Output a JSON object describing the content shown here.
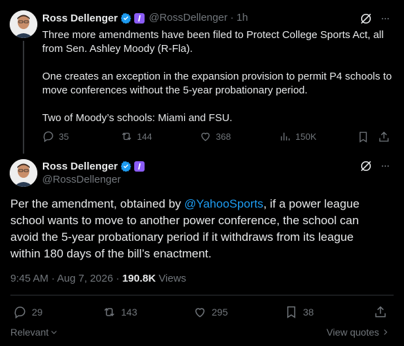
{
  "tweet1": {
    "name": "Ross Dellenger",
    "handle": "@RossDellenger",
    "time": "1h",
    "paragraphs": [
      "Three more amendments have been filed to Protect College Sports Act, all from Sen. Ashley Moody (R-Fla).",
      "One creates an exception in the expansion provision to permit P4 schools to move conferences without the 5-year probationary period.",
      "Two of Moody’s schools: Miami and FSU."
    ],
    "replies": "35",
    "reposts": "144",
    "likes": "368",
    "views": "150K"
  },
  "tweet2": {
    "name": "Ross Dellenger",
    "handle": "@RossDellenger",
    "text_before": "Per the amendment, obtained by ",
    "mention": "@YahooSports",
    "text_after": ", if a power league school wants to move to another power conference, the school can avoid the 5-year probationary period if it withdraws from its league within 180 days of the bill’s enactment.",
    "timestamp": "9:45 AM · Aug 7, 2026 · ",
    "views_count": "190.8K",
    "views_label": " Views",
    "replies": "29",
    "reposts": "143",
    "likes": "295",
    "bookmarks": "38"
  },
  "footer": {
    "sort_label": "Relevant",
    "view_quotes": "View quotes"
  },
  "colors": {
    "background": "#000000",
    "text": "#e7e9ea",
    "muted": "#71767b",
    "link": "#1d9bf0",
    "verified": "#1d9bf0",
    "badge": "#8b5cf6"
  },
  "icons": [
    "grok-icon",
    "verified-icon",
    "reply-icon",
    "repost-icon",
    "like-icon",
    "views-icon",
    "bookmark-icon",
    "share-icon",
    "chevron-down-icon",
    "chevron-right-icon"
  ]
}
